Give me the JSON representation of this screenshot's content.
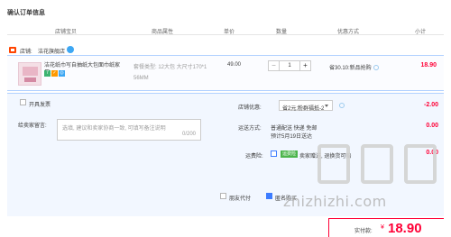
{
  "page": {
    "title": "确认订单信息"
  },
  "table_headers": {
    "shop_baby": "店铺宝贝",
    "attributes": "商品属性",
    "unit_price": "单价",
    "quantity": "数量",
    "discount": "优惠方式",
    "subtotal": "小计"
  },
  "shop": {
    "label": "店铺:",
    "name": "洁花旗舰店"
  },
  "item": {
    "title": "洁花纸巾写自抽纸大包面巾纸家用...",
    "sku_line1": "套餐类型: 12大包 大尺寸170*1",
    "sku_line2": "56MM",
    "unit_price": "49.00",
    "quantity": "1",
    "minus": "−",
    "plus": "+",
    "promo": "省30.10:新品抢购",
    "subtotal": "18.90"
  },
  "options": {
    "invoice": "开具发票",
    "buyer_message_label": "给卖家留言:",
    "buyer_message_placeholder": "选填, 建议和卖家协商一致, 可填写备注说明",
    "buyer_message_count": "0/200",
    "store_discount_label": "店铺优惠:",
    "store_discount_value": "省2元:粉群福抵-2",
    "store_discount_amount": "-2.00",
    "shipping_label": "运送方式:",
    "shipping_value": "普通配送 快递 免邮",
    "shipping_eta": "预计5月19日送达",
    "shipping_amount": "0.00",
    "insurance_label": "运费险:",
    "insurance_tag": "运费险",
    "insurance_text": "卖家赠送, 退换货可赔",
    "insurance_amount": "0.00"
  },
  "bottom": {
    "friend_pay": "朋友代付",
    "anonymous": "匿名购买"
  },
  "watermark": {
    "text": "zhizhizhi.com"
  },
  "payment": {
    "label": "实付款:",
    "currency": "¥",
    "amount": "18.90"
  }
}
